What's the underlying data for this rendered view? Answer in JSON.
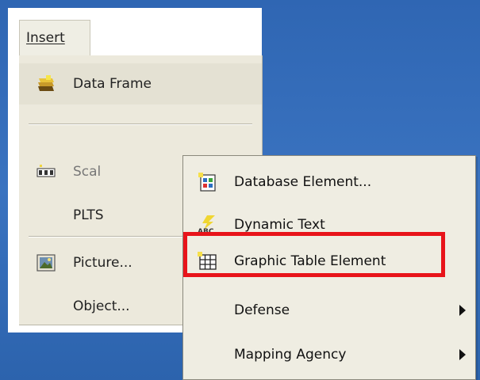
{
  "menubar": {
    "insert_label": "Insert"
  },
  "insert_menu": {
    "items": [
      {
        "label": "Data Frame",
        "icon": "data-frame-icon"
      },
      {
        "label": "Scal",
        "icon": "scale-bar-icon"
      },
      {
        "label": "PLTS",
        "icon": ""
      },
      {
        "label": "Picture...",
        "icon": "picture-icon"
      },
      {
        "label": "Object...",
        "icon": ""
      }
    ]
  },
  "submenu": {
    "items": [
      {
        "label": "Database Element...",
        "icon": "database-element-icon",
        "has_arrow": false
      },
      {
        "label": "Dynamic Text",
        "icon": "dynamic-text-icon",
        "has_arrow": false
      },
      {
        "label": "Graphic Table Element",
        "icon": "graphic-table-icon",
        "has_arrow": false
      },
      {
        "label": "Defense",
        "icon": "",
        "has_arrow": true
      },
      {
        "label": "Mapping Agency",
        "icon": "",
        "has_arrow": true
      }
    ],
    "highlighted": "Graphic Table Element"
  },
  "colors": {
    "background": "#3069b6",
    "menu_bg": "#ece9dc",
    "highlight_border": "#e8141a"
  }
}
